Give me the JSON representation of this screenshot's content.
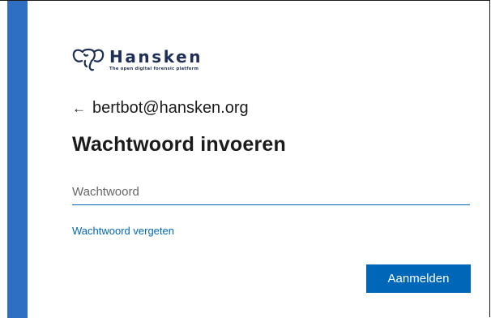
{
  "brand": {
    "name": "Hansken",
    "tagline": "The open digital forensic platform",
    "logo_icon": "elephant-icon",
    "accent_color": "#2e6fc4",
    "text_color": "#1f2f56"
  },
  "identity": {
    "back_icon": "arrow-left-icon",
    "back_glyph": "←",
    "email": "bertbot@hansken.org"
  },
  "title": "Wachtwoord invoeren",
  "password": {
    "placeholder": "Wachtwoord",
    "value": ""
  },
  "forgot_link": "Wachtwoord vergeten",
  "submit_button": "Aanmelden",
  "colors": {
    "primary": "#0067b8",
    "text": "#1b1b1b"
  }
}
